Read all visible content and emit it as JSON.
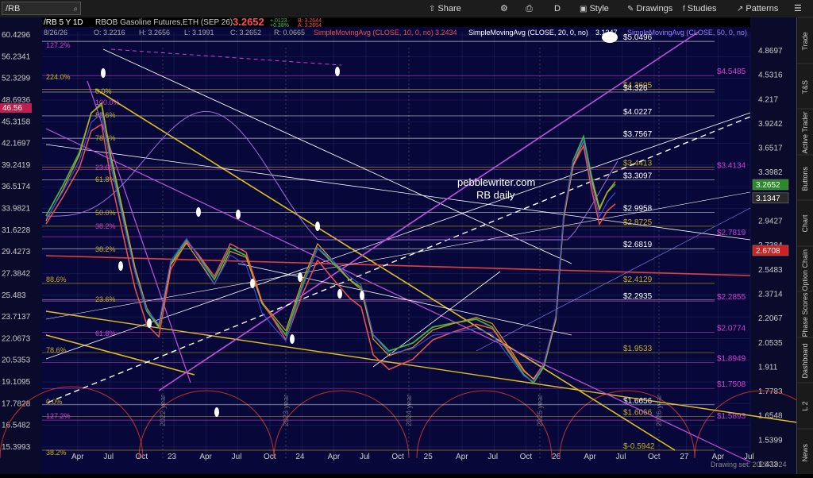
{
  "toolbar": {
    "symbol": "/RB",
    "share": "Share",
    "interval": "D",
    "style": "Style",
    "drawings": "Drawings",
    "studies": "Studies",
    "patterns": "Patterns"
  },
  "header": {
    "line1": "/RB 5 Y 1D",
    "desc": "RBOB Gasoline Futures,ETH (SEP 26)",
    "quote": "3.2652",
    "change": "+.0123",
    "change_pct": "+0.38%",
    "bid": "B: 3.2644",
    "ask": "A: 3.2654",
    "date": "8/26/26",
    "open": "O: 3.2216",
    "high": "H: 3.2656",
    "low": "L: 3.1991",
    "close": "C: 3.2652",
    "range": "R: 0.0665",
    "sma10": "SimpleMovingAvg (CLOSE, 10, 0, no)",
    "sma10_val": "3.2434",
    "sma20": "SimpleMovingAvg (CLOSE, 20, 0, no)",
    "sma20_val": "3.1347",
    "sma50": "SimpleMovingAvg (CLOSE, 50, 0, no)"
  },
  "colors": {
    "bg": "#07073a",
    "grid": "#1e2a60",
    "up": "#3bb54a",
    "down": "#e23b3b",
    "sma10": "#e0a020",
    "sma20": "#3b4bd8",
    "sma50": "#f05050",
    "purple": "#b060e0",
    "gold": "#c8b020",
    "violet": "#d040d0"
  },
  "watermark": {
    "line1": "pebblewriter.com",
    "line2": "RB daily"
  },
  "footer": {
    "drawing_set": "Drawing set: 2025-1024"
  },
  "right_rail": [
    "Trade",
    "T&S",
    "Active Trader",
    "Buttons",
    "Chart",
    "Option Chain",
    "Phase Scores",
    "Dashboard",
    "L 2",
    "News"
  ],
  "chart_data": {
    "type": "candlestick",
    "ylim": [
      1.45,
      5.2
    ],
    "y_ticks": [
      "60.4296",
      "56.2341",
      "52.3299",
      "48.6936",
      "45.3158",
      "42.1697",
      "39.2419",
      "36.5174",
      "33.9821",
      "31.6228",
      "29.4273",
      "27.3842",
      "25.483",
      "23.7137",
      "22.0673",
      "20.5353",
      "19.1095",
      "17.7828",
      "16.5482",
      "15.3993"
    ],
    "right_ticks": [
      "4.8697",
      "4.5316",
      "4.217",
      "3.9242",
      "3.6517",
      "3.3982",
      "3.1623",
      "2.9427",
      "2.7384",
      "2.5483",
      "2.3714",
      "2.2067",
      "2.0535",
      "1.911",
      "1.7783",
      "1.6548",
      "1.5399",
      "1.433"
    ],
    "x_ticks": [
      "Apr",
      "Jul",
      "Oct",
      "23",
      "Apr",
      "Jul",
      "Oct",
      "24",
      "Apr",
      "Jul",
      "Oct",
      "25",
      "Apr",
      "Jul",
      "Oct",
      "26",
      "Apr",
      "Jul",
      "Oct",
      "27",
      "Apr",
      "Jul"
    ],
    "price_labels": [
      {
        "text": "$5.0496",
        "value": 5.0496,
        "color": "#ffffff"
      },
      {
        "text": "$4.5485",
        "value": 4.5485,
        "color": "#d040d0"
      },
      {
        "text": "$4.3605",
        "value": 4.3605,
        "color": "#c8b020"
      },
      {
        "text": "$4.326",
        "value": 4.326,
        "color": "#ffffff"
      },
      {
        "text": "$4.0227",
        "value": 4.0227,
        "color": "#ffffff"
      },
      {
        "text": "$3.7567",
        "value": 3.7567,
        "color": "#ffffff"
      },
      {
        "text": "$3.4413",
        "value": 3.4413,
        "color": "#c8b020"
      },
      {
        "text": "$3.4134",
        "value": 3.4134,
        "color": "#d040d0"
      },
      {
        "text": "$3.3097",
        "value": 3.3097,
        "color": "#ffffff"
      },
      {
        "text": "$2.9958",
        "value": 2.9958,
        "color": "#ffffff"
      },
      {
        "text": "$2.8725",
        "value": 2.8725,
        "color": "#c8b020"
      },
      {
        "text": "$2.7819",
        "value": 2.7819,
        "color": "#d040d0"
      },
      {
        "text": "$2.6819",
        "value": 2.6819,
        "color": "#ffffff"
      },
      {
        "text": "$2.4129",
        "value": 2.4129,
        "color": "#c8b020"
      },
      {
        "text": "$2.2935",
        "value": 2.2935,
        "color": "#ffffff"
      },
      {
        "text": "$2.2855",
        "value": 2.2855,
        "color": "#d040d0"
      },
      {
        "text": "$2.0774",
        "value": 2.0774,
        "color": "#d040d0"
      },
      {
        "text": "$1.9533",
        "value": 1.9533,
        "color": "#c8b020"
      },
      {
        "text": "$1.8949",
        "value": 1.8949,
        "color": "#d040d0"
      },
      {
        "text": "$1.7508",
        "value": 1.7508,
        "color": "#d040d0"
      },
      {
        "text": "$1.6656",
        "value": 1.6656,
        "color": "#ffffff"
      },
      {
        "text": "$1.6066",
        "value": 1.6066,
        "color": "#c8b020"
      },
      {
        "text": "$1.5893",
        "value": 1.5893,
        "color": "#d040d0"
      },
      {
        "text": "$-0.5942",
        "value": 1.45,
        "color": "#c8b020"
      }
    ],
    "fib_labels": [
      "127.2%",
      "224.0%",
      "0.0%",
      "100.0%",
      "88.6%",
      "78.6%",
      "23.6%",
      "61.8%",
      "50.0%",
      "38.2%",
      "38.2%",
      "23.6%",
      "61.8%",
      "78.6%",
      "0.0%",
      "127.2%",
      "38.2%",
      "88.6%"
    ],
    "last_price_tags": [
      {
        "text": "3.2652",
        "value": 3.2652,
        "color": "#2a8a2a"
      },
      {
        "text": "3.1347",
        "value": 3.1347,
        "color": "#2a2a2a"
      },
      {
        "text": "2.6708",
        "value": 2.6708,
        "color": "#d02020"
      }
    ],
    "left_tag": {
      "text": "46.56"
    },
    "year_labels": [
      "2022 year",
      "2023 year",
      "2024 year",
      "2025 year",
      "2026 year"
    ]
  }
}
